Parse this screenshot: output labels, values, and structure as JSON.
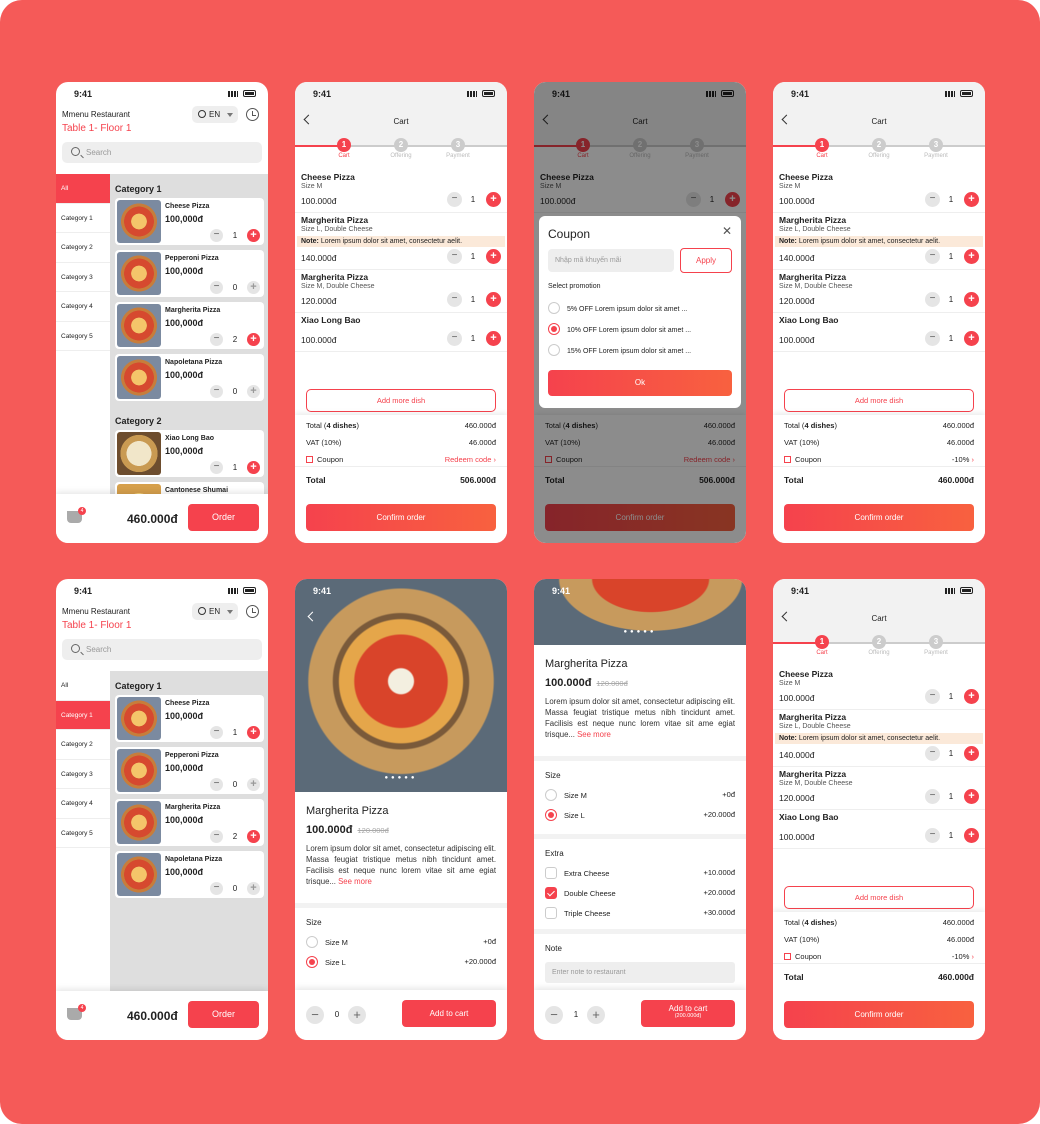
{
  "status": {
    "time": "9:41"
  },
  "menu": {
    "restaurant": "Mmenu Restaurant",
    "table": "Table 1- Floor 1",
    "lang": "EN",
    "search_placeholder": "Search",
    "categories": [
      "All",
      "Category 1",
      "Category 2",
      "Category 3",
      "Category 4",
      "Category 5"
    ],
    "cat1_title": "Category 1",
    "cat2_title": "Category 2",
    "items": [
      {
        "name": "Cheese Pizza",
        "price": "100,000đ",
        "qty": "1"
      },
      {
        "name": "Pepperoni Pizza",
        "price": "100,000đ",
        "qty": "0"
      },
      {
        "name": "Margherita Pizza",
        "price": "100,000đ",
        "qty": "2"
      },
      {
        "name": "Napoletana Pizza",
        "price": "100,000đ",
        "qty": "0"
      }
    ],
    "cat2_items": [
      {
        "name": "Xiao Long Bao",
        "price": "100,000đ",
        "qty": "1"
      },
      {
        "name": "Cantonese Shumai"
      }
    ],
    "cart_badge": "4",
    "total": "460.000đ",
    "order_label": "Order"
  },
  "cart": {
    "title": "Cart",
    "steps": [
      {
        "n": "1",
        "label": "Cart"
      },
      {
        "n": "2",
        "label": "Offering"
      },
      {
        "n": "3",
        "label": "Payment"
      }
    ],
    "items": [
      {
        "name": "Cheese Pizza",
        "size": "Size M",
        "note": "",
        "price": "100.000đ",
        "qty": "1"
      },
      {
        "name": "Margherita Pizza",
        "size": "Size L, Double Cheese",
        "note_label": "Note:",
        "note": "Lorem ipsum dolor sit amet, consectetur aelit.",
        "price": "140.000đ",
        "qty": "1"
      },
      {
        "name": "Margherita Pizza",
        "size": "Size M, Double Cheese",
        "note": "",
        "price": "120.000đ",
        "qty": "1"
      },
      {
        "name": "Xiao Long Bao",
        "size": "",
        "note": "",
        "price": "100.000đ",
        "qty": "1"
      }
    ],
    "add_more": "Add more dish",
    "total_label_pre": "Total (",
    "total_count": "4 dishes",
    "total_label_post": ")",
    "total_value": "460.000đ",
    "vat_label": "VAT (10%)",
    "vat_value": "46.000đ",
    "coupon_label": "Coupon",
    "redeem": "Redeem code",
    "discount": "-10%",
    "grand_label": "Total",
    "grand_value": "506.000đ",
    "grand_value_discounted": "460.000đ",
    "confirm": "Confirm order"
  },
  "coupon": {
    "title": "Coupon",
    "placeholder": "Nhập mã khuyến mãi",
    "apply": "Apply",
    "select_label": "Select promotion",
    "options": [
      "5% OFF Lorem ipsum dolor sit amet ...",
      "10% OFF Lorem ipsum dolor sit amet ...",
      "15% OFF Lorem ipsum dolor sit amet ..."
    ],
    "ok": "Ok"
  },
  "detail": {
    "name": "Margherita Pizza",
    "price": "100.000đ",
    "old_price": "120.000đ",
    "desc": "Lorem ipsum dolor sit amet, consectetur adipiscing elit. Massa feugiat tristique metus nibh tincidunt amet. Facilisis est neque nunc lorem vitae sit ame egiat trisque...",
    "desc2": "Lorem ipsum dolor sit amet, consectetur adipiscing elit. Massa feugiat tristique metus nibh tincidunt amet. Facilisis est neque nunc lorem vitae sit ame egiat trisque...",
    "see_more": "See more",
    "size_title": "Size",
    "sizes": [
      {
        "label": "Size M",
        "price": "+0đ"
      },
      {
        "label": "Size L",
        "price": "+20.000đ"
      }
    ],
    "extra_title": "Extra",
    "extras": [
      {
        "label": "Extra Cheese",
        "price": "+10.000đ"
      },
      {
        "label": "Double Cheese",
        "price": "+20.000đ"
      },
      {
        "label": "Triple Cheese",
        "price": "+30.000đ"
      }
    ],
    "note_title": "Note",
    "note_placeholder": "Enter note to restaurant",
    "qty0": "0",
    "qty1": "1",
    "add_to_cart": "Add to cart",
    "add_sub": "(200.000đ)"
  },
  "colors": {
    "accent": "#f5424d",
    "background": "#f55a58"
  }
}
